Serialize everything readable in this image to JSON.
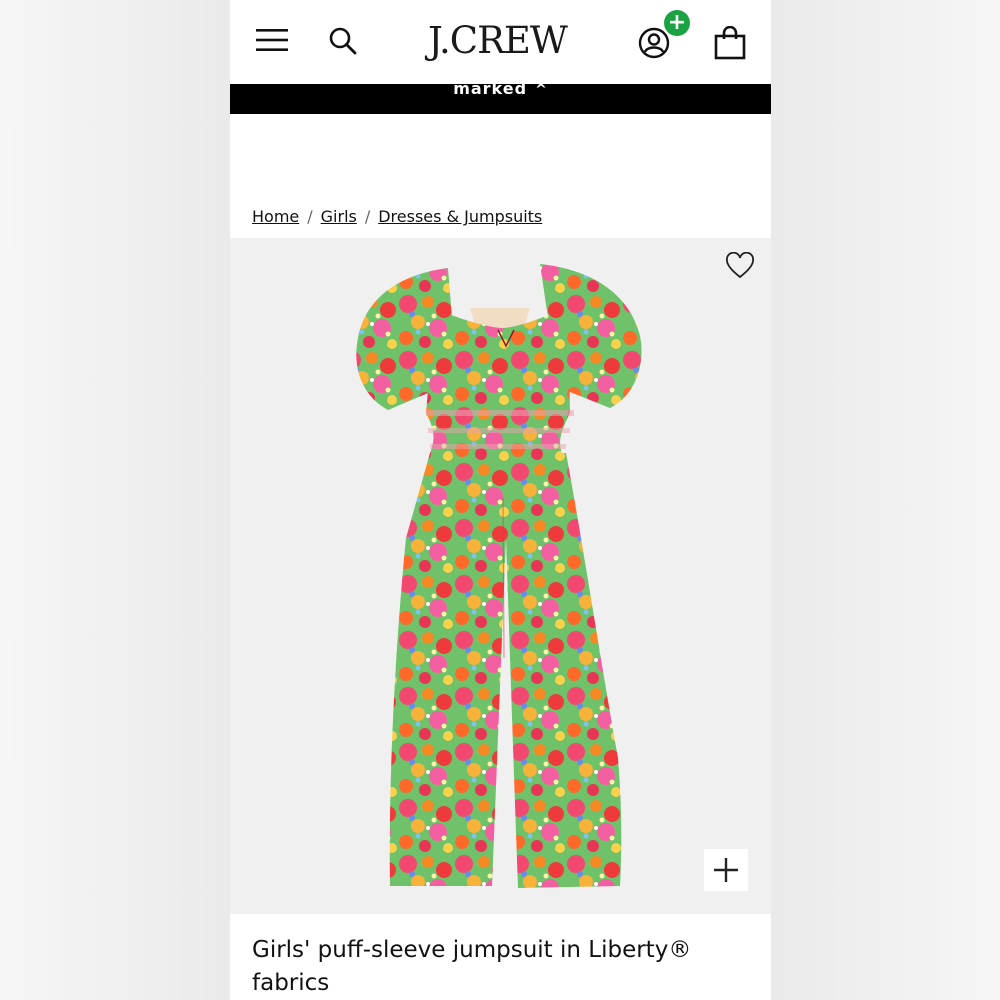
{
  "brand": {
    "logo_text": "J.CREW"
  },
  "header": {
    "menu_icon": "hamburger-menu-icon",
    "search_icon": "search-icon",
    "account_icon": "account-icon",
    "account_badge": "+",
    "bag_icon": "shopping-bag-icon"
  },
  "banner": {
    "text": "marked",
    "caret": "^"
  },
  "breadcrumb": {
    "items": [
      {
        "label": "Home"
      },
      {
        "label": "Girls"
      },
      {
        "label": "Dresses & Jumpsuits"
      }
    ],
    "separator": "/"
  },
  "product": {
    "title": "Girls' puff-sleeve jumpsuit in Liberty® fabrics",
    "favorite_icon": "heart-icon",
    "zoom_icon": "plus-icon"
  },
  "colors": {
    "badge": "#1aa243",
    "banner_bg": "#000000",
    "image_bg": "#f0f0f0"
  }
}
